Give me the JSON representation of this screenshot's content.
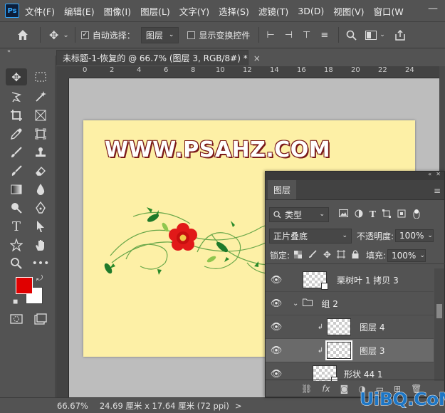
{
  "app": {
    "logo": "Ps"
  },
  "menu": [
    "文件(F)",
    "编辑(E)",
    "图像(I)",
    "图层(L)",
    "文字(Y)",
    "选择(S)",
    "滤镜(T)",
    "3D(D)",
    "视图(V)",
    "窗口(W"
  ],
  "options": {
    "auto_select_label": "自动选择：",
    "auto_select_value": "图层",
    "show_transform_label": "显示变换控件"
  },
  "document": {
    "tab_title": "未标题-1-恢复的 @ 66.7% (图层 3, RGB/8#) *",
    "close_glyph": "×",
    "watermark": "WWW.PSAHZ.COM",
    "background_color": "#fdf0a6"
  },
  "ruler": {
    "ticks": [
      "0",
      "2",
      "4",
      "6",
      "8",
      "10",
      "12",
      "14",
      "16",
      "18",
      "20",
      "22",
      "24"
    ]
  },
  "status": {
    "zoom": "66.67%",
    "size": "24.69 厘米 x 17.64 厘米 (72 ppi)",
    "arrow": ">"
  },
  "layers_panel": {
    "tab": "图层",
    "filter_label": "类型",
    "blend_mode": "正片叠底",
    "opacity_label": "不透明度:",
    "opacity_value": "100%",
    "lock_label": "锁定:",
    "fill_label": "填充:",
    "fill_value": "100%",
    "layers": [
      {
        "name": "栗树叶 1 拷贝 3",
        "type": "layer",
        "visible": true
      },
      {
        "name": "组 2",
        "type": "group",
        "visible": true
      },
      {
        "name": "图层 4",
        "type": "clipped",
        "visible": true
      },
      {
        "name": "图层 3",
        "type": "clipped",
        "visible": true,
        "selected": true
      },
      {
        "name": "形状 44 1",
        "type": "layer",
        "visible": true
      }
    ],
    "footer_icons": [
      "link-icon",
      "fx-icon",
      "mask-icon",
      "adjustment-icon",
      "folder-icon",
      "new-layer-icon",
      "trash-icon"
    ],
    "footer_fx": "fx"
  },
  "colors": {
    "foreground": "#e00000",
    "background": "#ffffff",
    "accent": "#31a8ff"
  },
  "watermark_site": "UiBQ.CoM"
}
